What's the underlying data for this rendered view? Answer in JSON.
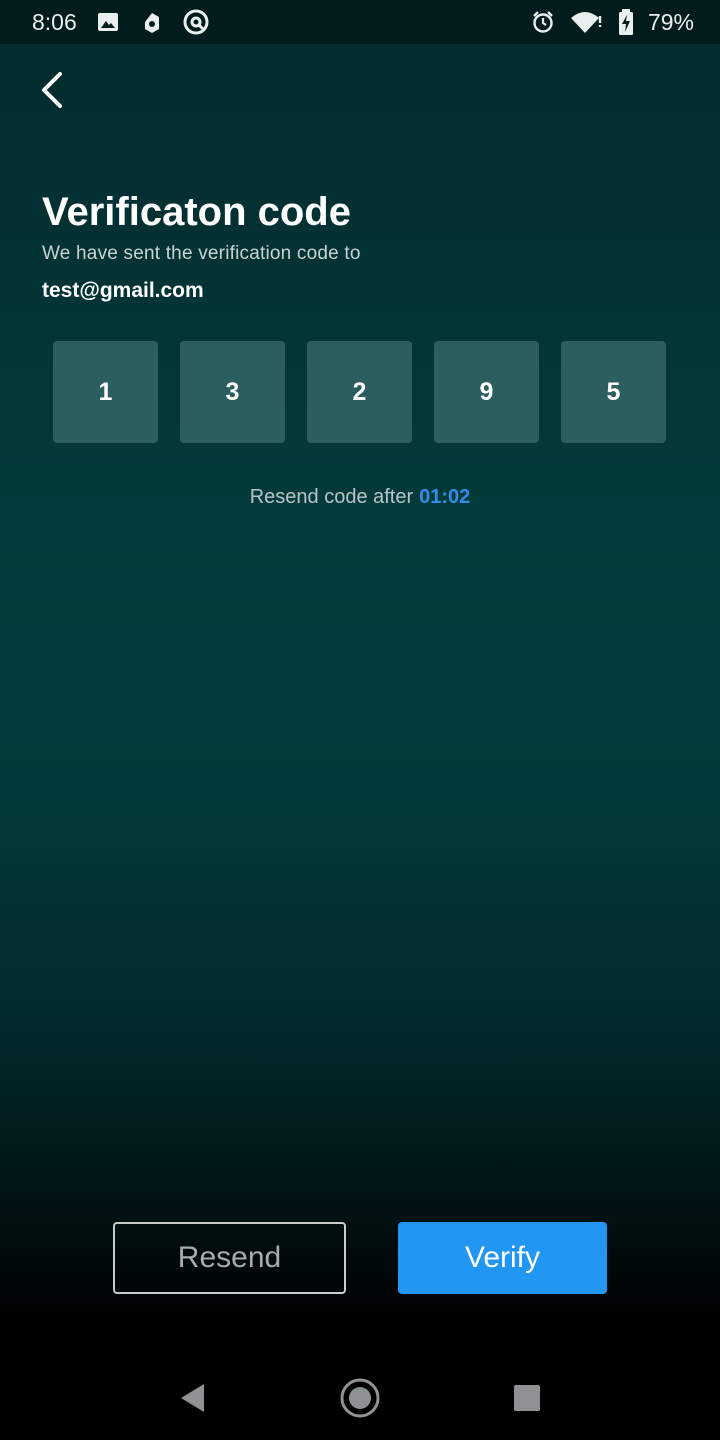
{
  "status_bar": {
    "time": "8:06",
    "battery": "79%",
    "icons_left": [
      "image-icon",
      "music-app-icon",
      "no-disturb-icon"
    ],
    "icons_right": [
      "alarm-icon",
      "wifi-icon",
      "battery-charging-icon"
    ]
  },
  "header": {
    "back_icon": "chevron-left-icon"
  },
  "main": {
    "title": "Verificaton code",
    "subtitle": "We have sent the verification code to",
    "email": "test@gmail.com",
    "code_digits": [
      "1",
      "3",
      "2",
      "9",
      "5"
    ],
    "resend_prefix": "Resend code after",
    "timer": "01:02"
  },
  "actions": {
    "resend_label": "Resend",
    "verify_label": "Verify"
  },
  "colors": {
    "accent": "#2196f3",
    "timer": "#2e8ee8",
    "code_box": "#2d5e5f",
    "background_top": "#022a2c"
  },
  "nav_bar": {
    "icons": [
      "back-triangle-icon",
      "home-circle-icon",
      "recents-square-icon"
    ]
  }
}
